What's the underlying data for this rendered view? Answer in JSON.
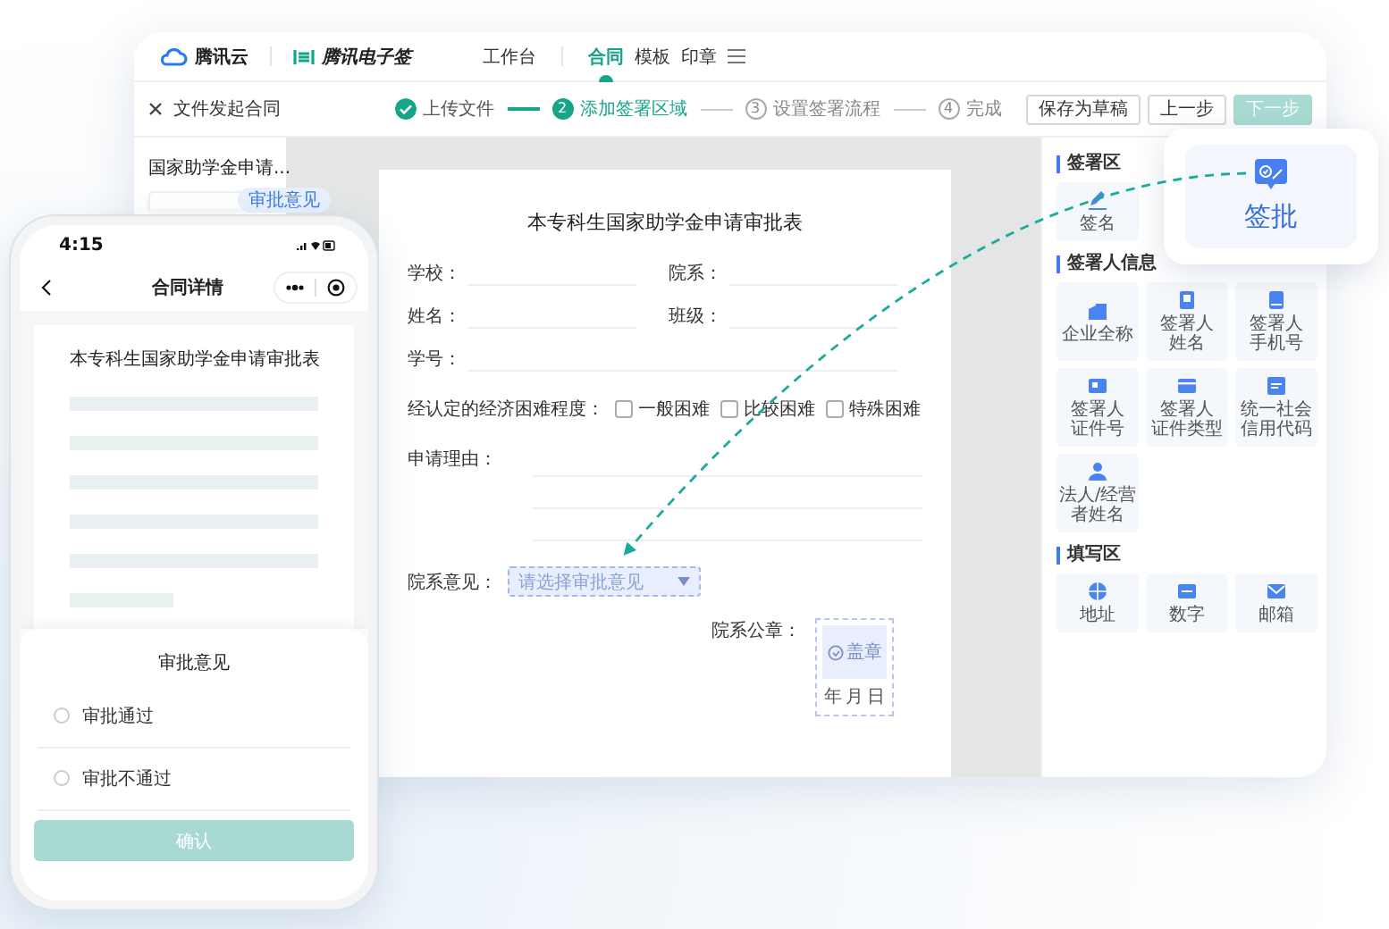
{
  "desktop_window": {
    "brand": {
      "logo": "腾讯云",
      "product": "腾讯电子签"
    },
    "nav": [
      {
        "label": "工作台",
        "selected": false
      },
      {
        "label": "合同",
        "selected": true
      },
      {
        "label": "模板",
        "selected": false
      },
      {
        "label": "印章",
        "selected": false
      }
    ],
    "page_title": "文件发起合同",
    "steps": [
      {
        "label": "上传文件",
        "done": true,
        "selected": false
      },
      {
        "number": "2",
        "label": "添加签署区域",
        "done": false,
        "selected": true
      },
      {
        "number": "3",
        "label": "设置签署流程",
        "done": false,
        "selected": false
      },
      {
        "number": "4",
        "label": "完成",
        "done": false,
        "selected": false
      }
    ],
    "buttons": [
      {
        "label": "保存为草稿",
        "disabled": false
      },
      {
        "label": "上一步",
        "disabled": false
      },
      {
        "label": "下一步",
        "disabled": true
      }
    ],
    "file_list": {
      "file_name": "国家助学金申请...",
      "tag": "审批意见"
    },
    "document": {
      "title": "本专科生国家助学金申请审批表",
      "fields": [
        {
          "label": "学校：",
          "kind": "half"
        },
        {
          "label": "院系：",
          "kind": "half"
        },
        {
          "label": "姓名：",
          "kind": "half"
        },
        {
          "label": "班级：",
          "kind": "half"
        },
        {
          "label": "学号：",
          "kind": "full"
        }
      ],
      "difficulty": {
        "label": "经认定的经济困难程度：",
        "options": [
          {
            "label": "一般困难",
            "checked": false
          },
          {
            "label": "比较困难",
            "checked": false
          },
          {
            "label": "特殊困难",
            "checked": false
          }
        ]
      },
      "reason_label": "申请理由：",
      "opinion": {
        "label": "院系意见：",
        "placeholder": "请选择审批意见"
      },
      "seal": {
        "label": "院系公章：",
        "button": "盖章",
        "date": [
          "年",
          "月",
          "日"
        ]
      }
    },
    "field_panel": [
      {
        "title": "签署区",
        "items": [
          [
            "签名"
          ]
        ]
      },
      {
        "title": "签署人信息",
        "items": [
          [
            "企业全称"
          ],
          [
            "签署人",
            "姓名"
          ],
          [
            "签署人",
            "手机号"
          ],
          [
            "签署人",
            "证件号"
          ],
          [
            "签署人",
            "证件类型"
          ],
          [
            "统一社会",
            "信用代码"
          ],
          [
            "法人/经营",
            "者姓名"
          ]
        ]
      },
      {
        "title": "填写区",
        "items": [
          [
            "地址"
          ],
          [
            "数字"
          ],
          [
            "邮箱"
          ]
        ]
      }
    ]
  },
  "popup": {
    "label": "签批"
  },
  "phone": {
    "time": "4:15",
    "title": "合同详情",
    "document_title": "本专科生国家助学金申请审批表",
    "sheet": {
      "title": "审批意见",
      "options": [
        {
          "label": "审批通过",
          "selected": false
        },
        {
          "label": "审批不通过",
          "selected": false
        }
      ],
      "confirm": "确认"
    }
  }
}
